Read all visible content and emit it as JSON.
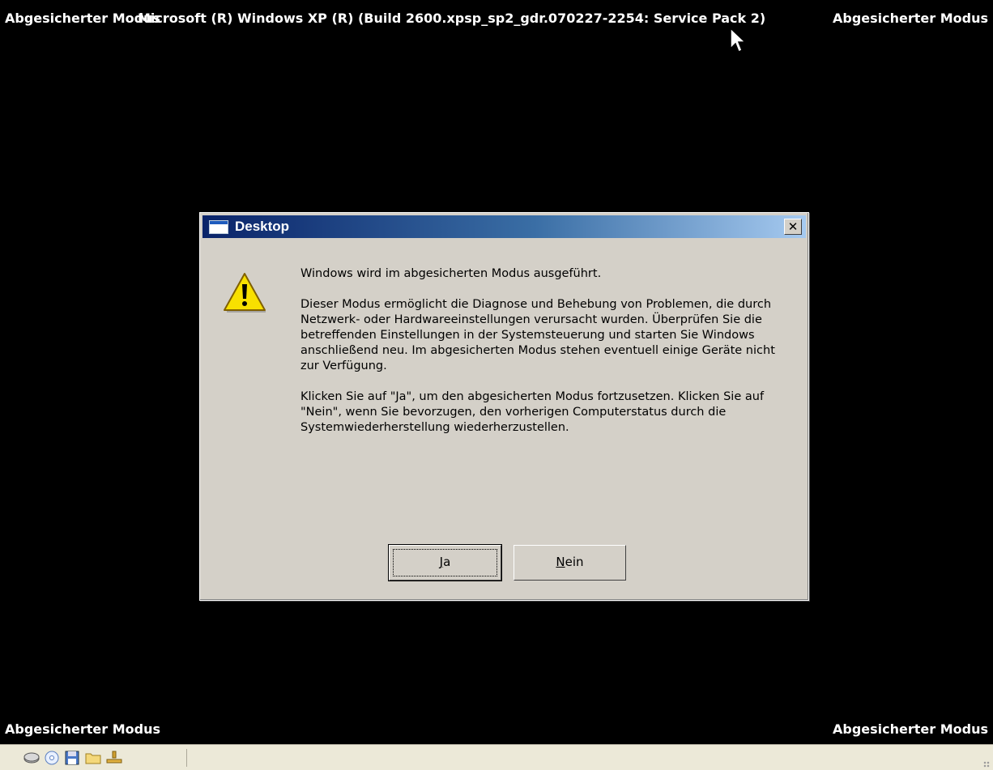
{
  "overlay": {
    "top_left": "Abgesicherter Modus",
    "top_center": "Microsoft (R) Windows XP (R) (Build 2600.xpsp_sp2_gdr.070227-2254: Service Pack 2)",
    "top_right": "Abgesicherter Modus",
    "bottom_left": "Abgesicherter Modus",
    "bottom_right": "Abgesicherter Modus"
  },
  "dialog": {
    "title": "Desktop",
    "close_glyph": "✕",
    "paragraphs": [
      "Windows wird im abgesicherten Modus ausgeführt.",
      "Dieser Modus ermöglicht die Diagnose und Behebung von Problemen, die durch Netzwerk- oder Hardwareeinstellungen verursacht wurden. Überprüfen Sie die betreffenden Einstellungen in der Systemsteuerung und starten Sie Windows anschließend neu. Im abgesicherten Modus stehen eventuell einige Geräte nicht zur Verfügung.",
      "Klicken Sie auf \"Ja\", um den abgesicherten Modus fortzusetzen. Klicken Sie auf \"Nein\", wenn Sie bevorzugen, den vorherigen Computerstatus durch die Systemwiederherstellung wiederherzustellen."
    ],
    "buttons": {
      "yes": {
        "mnemonic": "J",
        "rest": "a"
      },
      "no": {
        "mnemonic": "N",
        "rest": "ein"
      }
    },
    "icon": "warning-icon"
  },
  "statusbar": {
    "icons": [
      "hard-disk-icon",
      "cd-drive-icon",
      "floppy-disk-icon",
      "shared-folder-icon",
      "network-icon"
    ]
  },
  "colors": {
    "background": "#000000",
    "dialog_face": "#d4d0c8",
    "titlebar_start": "#0a246a",
    "titlebar_end": "#a6caf0"
  }
}
